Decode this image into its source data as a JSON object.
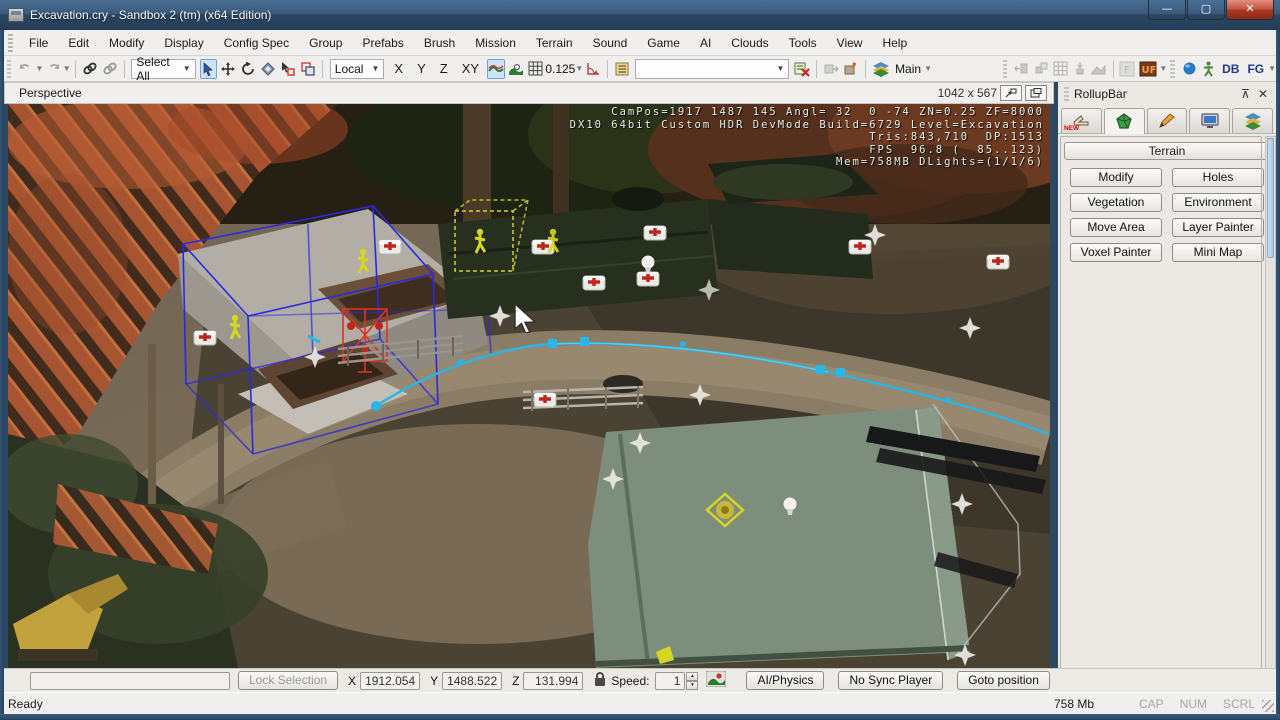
{
  "window": {
    "title": "Excavation.cry - Sandbox 2 (tm) (x64 Edition)",
    "minimize": "—",
    "maximize": "▢",
    "close": "✕"
  },
  "menu": {
    "items": [
      "File",
      "Edit",
      "Modify",
      "Display",
      "Config Spec",
      "Group",
      "Prefabs",
      "Brush",
      "Mission",
      "Terrain",
      "Sound",
      "Game",
      "AI",
      "Clouds",
      "Tools",
      "View",
      "Help"
    ]
  },
  "toolbar": {
    "select_all": "Select All",
    "local": "Local",
    "axis_x": "X",
    "axis_y": "Y",
    "axis_z": "Z",
    "axis_xy": "XY",
    "grid_size": "0.125",
    "object_filter": "",
    "main_layer": "Main",
    "f_label": "F",
    "uf_label": "UF",
    "db_label": "DB",
    "fg_label": "FG"
  },
  "viewport": {
    "label": "Perspective",
    "size_label": "1042 x 567",
    "debug_lines": [
      "CamPos=1917 1487 145 Angl= 32  0 -74 ZN=0.25 ZF=8000",
      "DX10 64bit Custom HDR DevMode Build=6729 Level=Excavation",
      "Tris:843,710  DP:1513",
      "FPS  96.8 (  85..123)",
      "Mem=758MB DLights=(1/1/6)"
    ]
  },
  "rollupbar": {
    "title": "RollupBar",
    "pin": "⊼",
    "close": "✕",
    "tab_new_badge": "NEW",
    "section_header": "Terrain",
    "buttons": [
      "Modify",
      "Holes",
      "Vegetation",
      "Environment",
      "Move Area",
      "Layer Painter",
      "Voxel Painter",
      "Mini Map"
    ]
  },
  "bottom_bar": {
    "selection_filter_value": "",
    "lock_selection": "Lock Selection",
    "x_label": "X",
    "x_value": "1912.054",
    "y_label": "Y",
    "y_value": "1488.522",
    "z_label": "Z",
    "z_value": "131.994",
    "speed_label": "Speed:",
    "speed_value": "1",
    "ai_physics": "AI/Physics",
    "no_sync_player": "No Sync Player",
    "goto_position": "Goto position"
  },
  "status_bar": {
    "message": "Ready",
    "memory": "758 Mb",
    "caps": "CAP",
    "num": "NUM",
    "scroll": "SCRL"
  },
  "colors": {
    "selection_wireframe": "#2a2ae0",
    "path_spline": "#2ab8e8",
    "ai_character": "#d8d820",
    "accent_blue_highlight": "#cfe3f7"
  }
}
